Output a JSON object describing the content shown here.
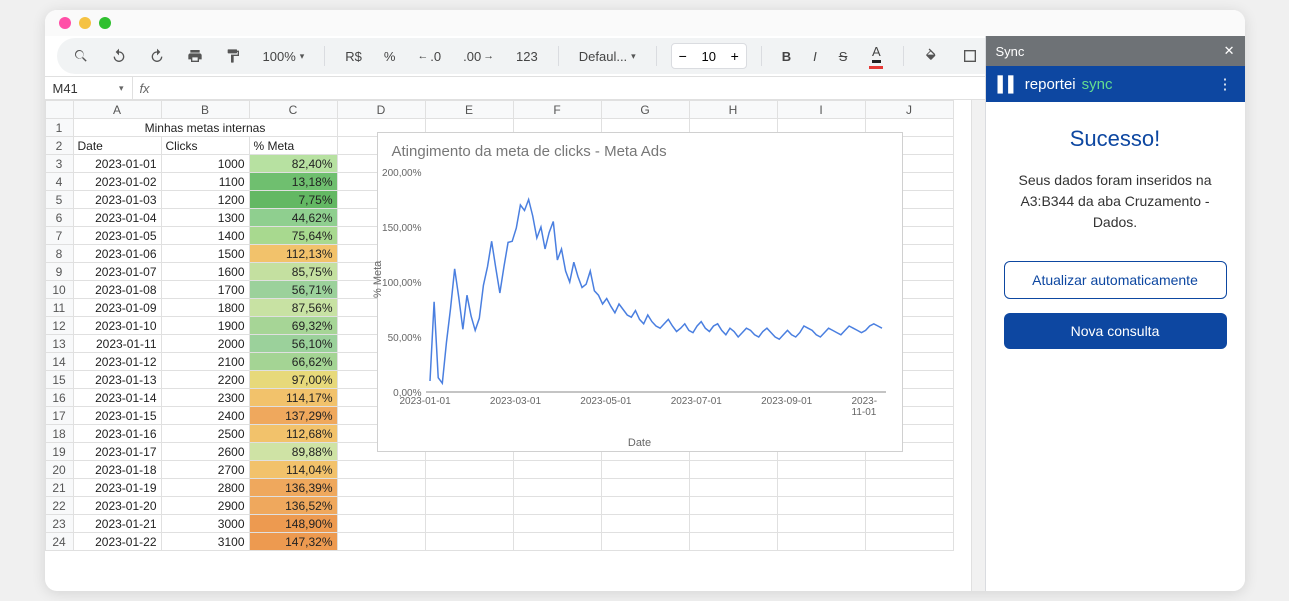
{
  "toolbar": {
    "zoom": "100%",
    "currency": "R$",
    "percent": "%",
    "dec_dec": ".0",
    "dec_inc": ".00",
    "num123": "123",
    "font": "Defaul...",
    "fontsize": "10",
    "bold": "B",
    "italic": "I",
    "strike": "S",
    "textA": "A"
  },
  "namebox": "M41",
  "columns": [
    "A",
    "B",
    "C",
    "D",
    "E",
    "F",
    "G",
    "H",
    "I",
    "J"
  ],
  "title_row": "Minhas metas internas",
  "headers": {
    "a": "Date",
    "b": "Clicks",
    "c": "% Meta"
  },
  "rows": [
    {
      "n": 3,
      "date": "2023-01-01",
      "clicks": "1000",
      "meta": "82,40%",
      "bg": "#b7e1a1"
    },
    {
      "n": 4,
      "date": "2023-01-02",
      "clicks": "1100",
      "meta": "13,18%",
      "bg": "#6fbf6f"
    },
    {
      "n": 5,
      "date": "2023-01-03",
      "clicks": "1200",
      "meta": "7,75%",
      "bg": "#63b863"
    },
    {
      "n": 6,
      "date": "2023-01-04",
      "clicks": "1300",
      "meta": "44,62%",
      "bg": "#8fcf8f"
    },
    {
      "n": 7,
      "date": "2023-01-05",
      "clicks": "1400",
      "meta": "75,64%",
      "bg": "#a8d98f"
    },
    {
      "n": 8,
      "date": "2023-01-06",
      "clicks": "1500",
      "meta": "112,13%",
      "bg": "#f2c26b"
    },
    {
      "n": 9,
      "date": "2023-01-07",
      "clicks": "1600",
      "meta": "85,75%",
      "bg": "#c4e0a0"
    },
    {
      "n": 10,
      "date": "2023-01-08",
      "clicks": "1700",
      "meta": "56,71%",
      "bg": "#9bd19b"
    },
    {
      "n": 11,
      "date": "2023-01-09",
      "clicks": "1800",
      "meta": "87,56%",
      "bg": "#c8e2a3"
    },
    {
      "n": 12,
      "date": "2023-01-10",
      "clicks": "1900",
      "meta": "69,32%",
      "bg": "#a6d596"
    },
    {
      "n": 13,
      "date": "2023-01-11",
      "clicks": "2000",
      "meta": "56,10%",
      "bg": "#9bd19b"
    },
    {
      "n": 14,
      "date": "2023-01-12",
      "clicks": "2100",
      "meta": "66,62%",
      "bg": "#a4d494"
    },
    {
      "n": 15,
      "date": "2023-01-13",
      "clicks": "2200",
      "meta": "97,00%",
      "bg": "#e7d97a"
    },
    {
      "n": 16,
      "date": "2023-01-14",
      "clicks": "2300",
      "meta": "114,17%",
      "bg": "#f2c26b"
    },
    {
      "n": 17,
      "date": "2023-01-15",
      "clicks": "2400",
      "meta": "137,29%",
      "bg": "#efa85d"
    },
    {
      "n": 18,
      "date": "2023-01-16",
      "clicks": "2500",
      "meta": "112,68%",
      "bg": "#f2c26b"
    },
    {
      "n": 19,
      "date": "2023-01-17",
      "clicks": "2600",
      "meta": "89,88%",
      "bg": "#cfe3a5"
    },
    {
      "n": 20,
      "date": "2023-01-18",
      "clicks": "2700",
      "meta": "114,04%",
      "bg": "#f2c26b"
    },
    {
      "n": 21,
      "date": "2023-01-19",
      "clicks": "2800",
      "meta": "136,39%",
      "bg": "#efa85d"
    },
    {
      "n": 22,
      "date": "2023-01-20",
      "clicks": "2900",
      "meta": "136,52%",
      "bg": "#efa85d"
    },
    {
      "n": 23,
      "date": "2023-01-21",
      "clicks": "3000",
      "meta": "148,90%",
      "bg": "#ed9a50"
    },
    {
      "n": 24,
      "date": "2023-01-22",
      "clicks": "3100",
      "meta": "147,32%",
      "bg": "#ed9a50"
    }
  ],
  "chart_data": {
    "type": "line",
    "title": "Atingimento da meta de clicks - Meta Ads",
    "xlabel": "Date",
    "ylabel": "% Meta",
    "ylim": [
      0,
      200
    ],
    "yticks": [
      "0,00%",
      "50,00%",
      "100,00%",
      "150,00%",
      "200,00%"
    ],
    "xticks": [
      "2023-01-01",
      "2023-03-01",
      "2023-05-01",
      "2023-07-01",
      "2023-09-01",
      "2023-11-01"
    ],
    "series": [
      {
        "name": "% Meta",
        "values": [
          10,
          82,
          13,
          8,
          45,
          76,
          112,
          86,
          57,
          88,
          69,
          56,
          67,
          97,
          114,
          137,
          113,
          90,
          114,
          136,
          137,
          149,
          170,
          165,
          175,
          160,
          140,
          150,
          130,
          145,
          155,
          120,
          130,
          110,
          100,
          118,
          105,
          95,
          98,
          110,
          92,
          88,
          80,
          85,
          78,
          72,
          80,
          75,
          70,
          68,
          74,
          66,
          62,
          70,
          64,
          60,
          58,
          62,
          66,
          60,
          55,
          58,
          62,
          56,
          54,
          60,
          64,
          58,
          55,
          60,
          62,
          56,
          52,
          58,
          55,
          50,
          54,
          58,
          56,
          52,
          50,
          55,
          58,
          54,
          50,
          48,
          52,
          56,
          52,
          50,
          54,
          60,
          58,
          56,
          52,
          50,
          54,
          58,
          56,
          54,
          52,
          56,
          60,
          58,
          56,
          54,
          56,
          60,
          62,
          60,
          58
        ]
      }
    ]
  },
  "sidebar": {
    "head": "Sync",
    "brand": "reportei",
    "brand_sync": "sync",
    "title": "Sucesso!",
    "msg": "Seus dados foram inseridos na A3:B344 da aba Cruzamento - Dados.",
    "btn1": "Atualizar automaticamente",
    "btn2": "Nova consulta"
  }
}
